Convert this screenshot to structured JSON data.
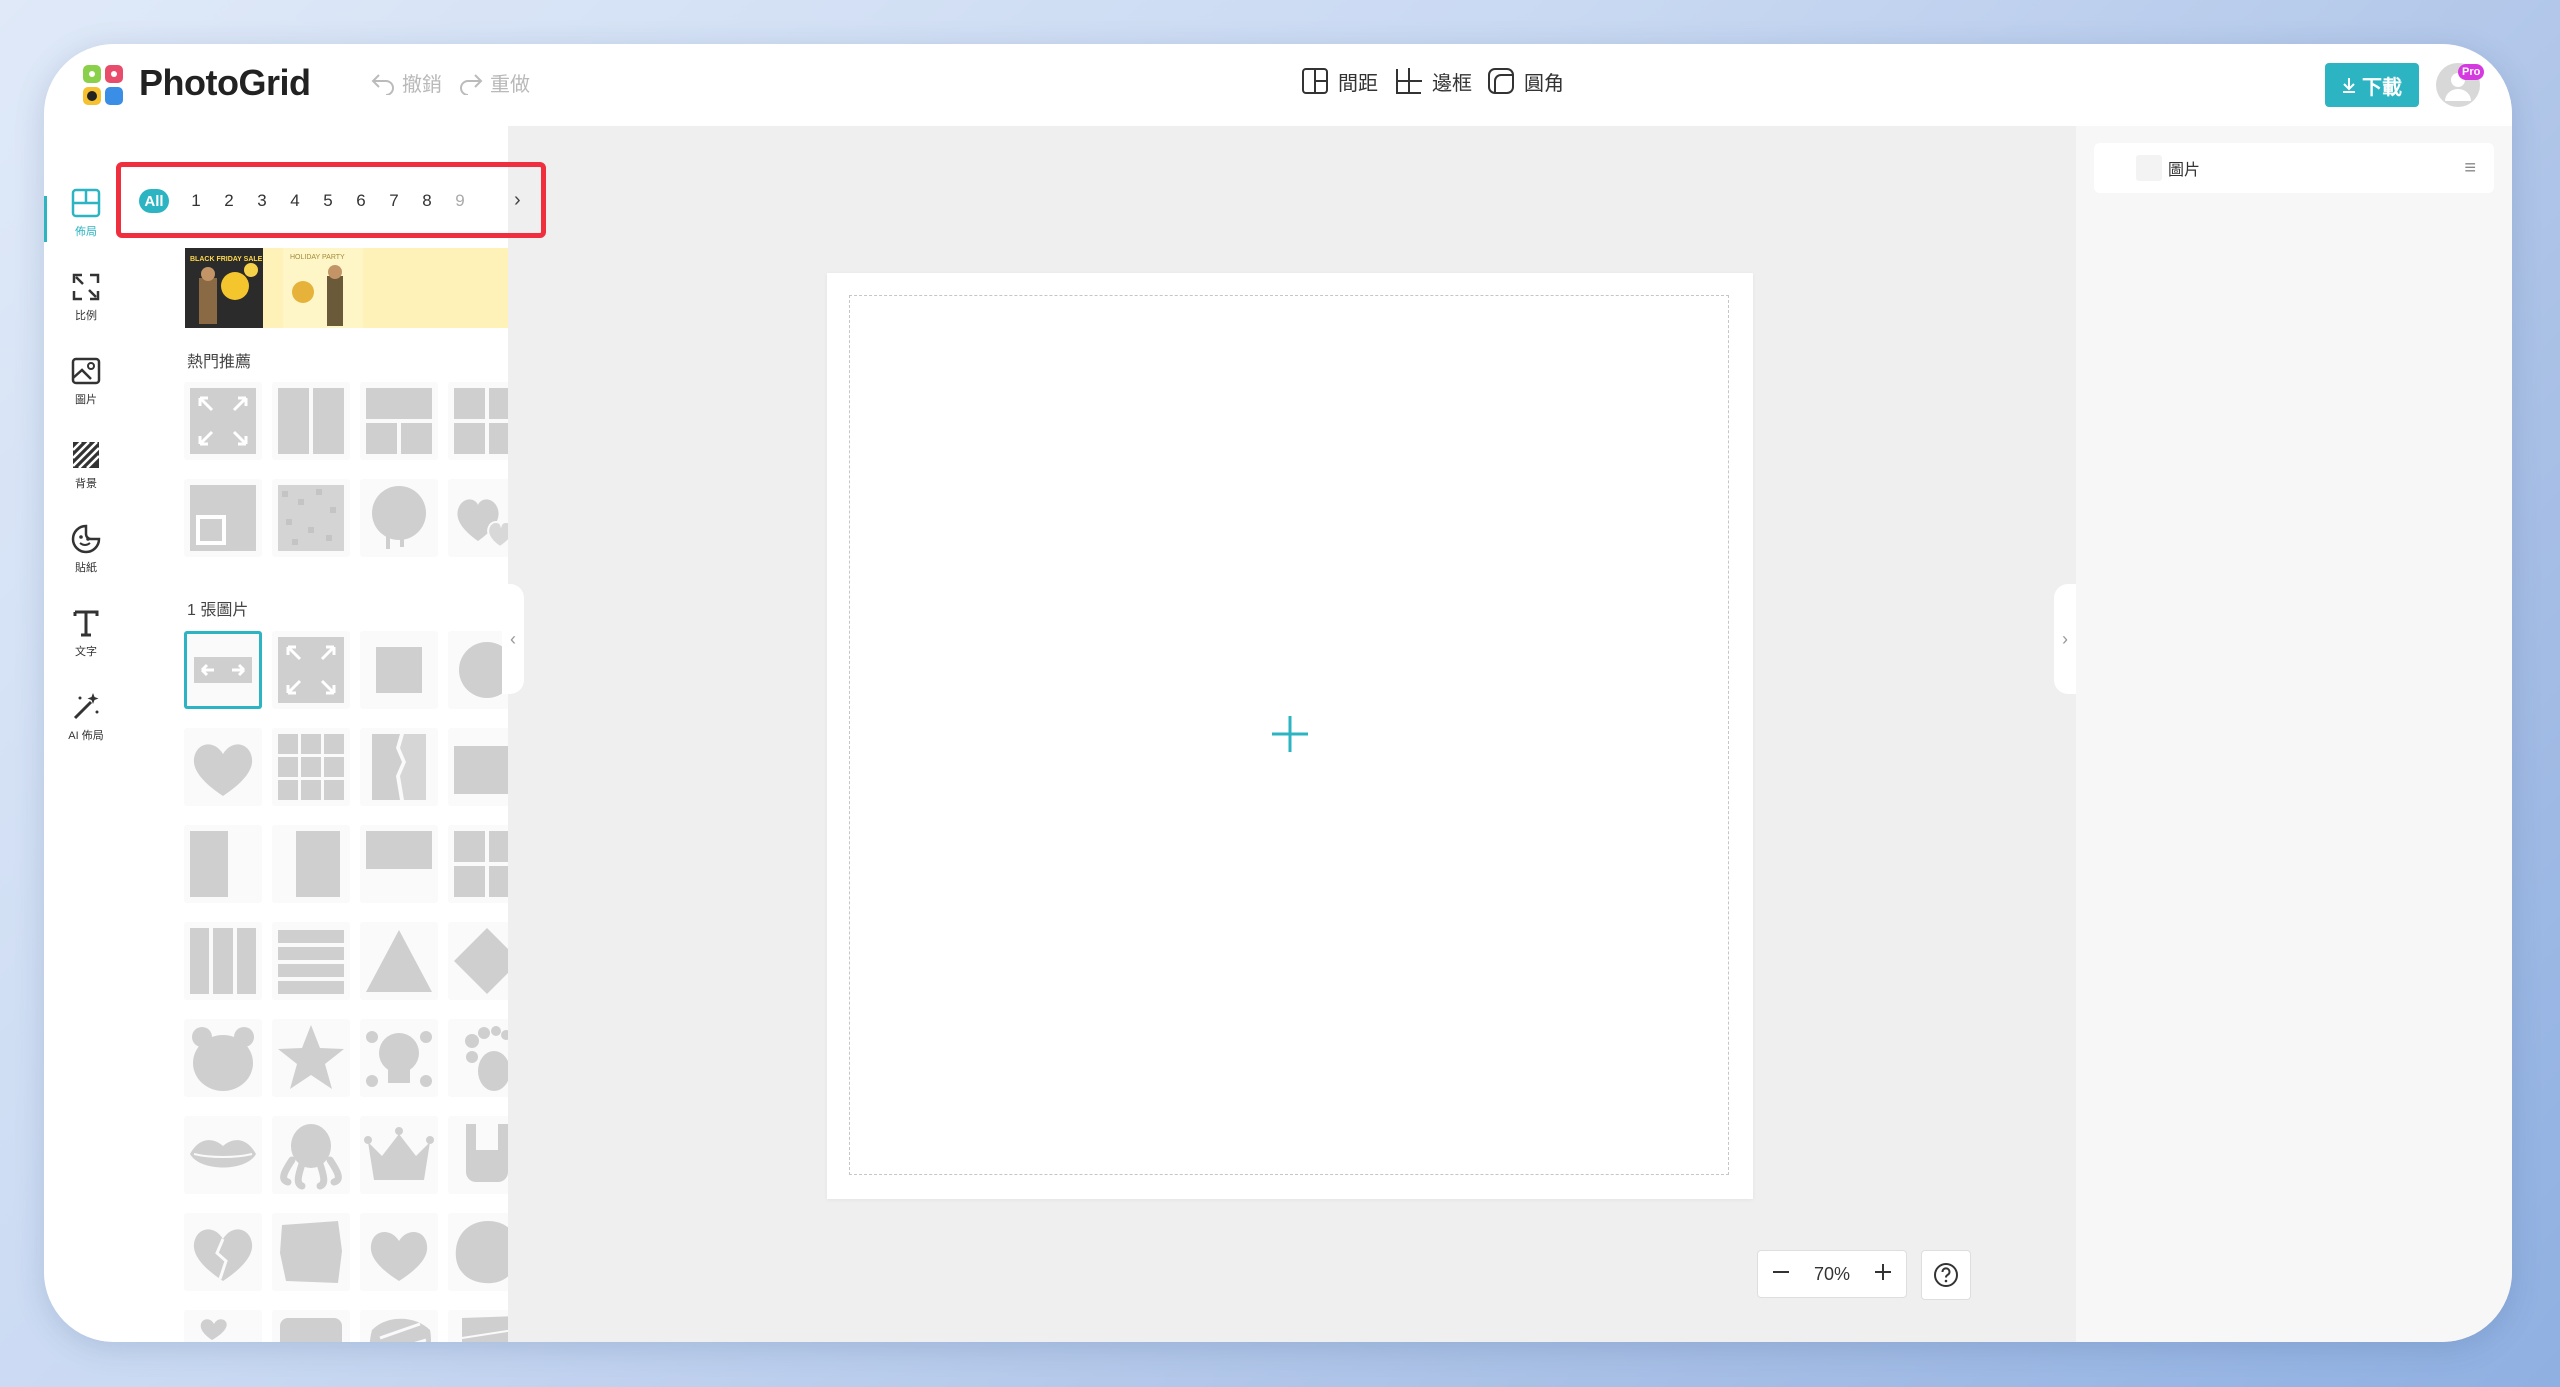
{
  "app": {
    "name": "PhotoGrid"
  },
  "toolbar": {
    "undo": "撤銷",
    "redo": "重做",
    "spacing": "間距",
    "border": "邊框",
    "corner": "圓角",
    "download": "下載",
    "pro": "Pro"
  },
  "sidebar": {
    "items": [
      {
        "label": "佈局",
        "icon": "layout-icon"
      },
      {
        "label": "比例",
        "icon": "ratio-icon"
      },
      {
        "label": "圖片",
        "icon": "image-icon"
      },
      {
        "label": "背景",
        "icon": "background-icon"
      },
      {
        "label": "貼紙",
        "icon": "sticker-icon"
      },
      {
        "label": "文字",
        "icon": "text-icon"
      },
      {
        "label": "AI 佈局",
        "icon": "magic-wand-icon"
      }
    ]
  },
  "pager": {
    "all": "All",
    "pages": [
      "1",
      "2",
      "3",
      "4",
      "5",
      "6",
      "7",
      "8",
      "9"
    ]
  },
  "banner": {
    "left_text": "BLACK FRIDAY SALE",
    "right_text": "HOLIDAY PARTY"
  },
  "panel": {
    "hot_title": "熱門推薦",
    "one_photo_title": "1 張圖片"
  },
  "canvas": {
    "zoom": "70%"
  },
  "right_panel": {
    "layer_label": "圖片"
  },
  "colors": {
    "accent": "#2cb4c2",
    "highlight": "#ef2f3e",
    "pro": "#d43adf"
  }
}
